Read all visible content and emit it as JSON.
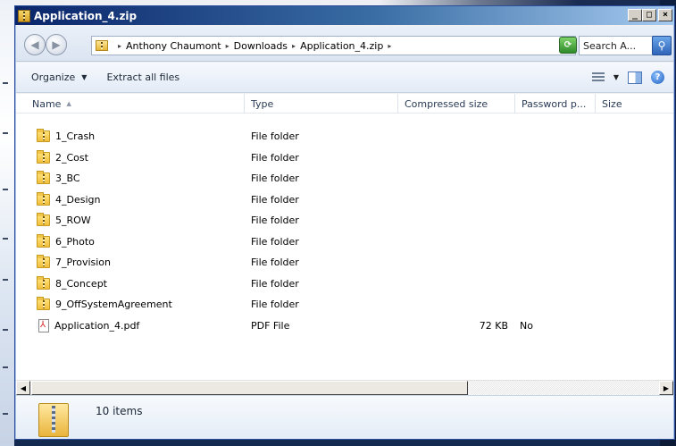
{
  "window": {
    "title": "Application_4.zip",
    "buttons": {
      "minimize": "_",
      "maximize": "□",
      "close": "×"
    }
  },
  "addressbar": {
    "back_icon": "back-arrow-icon",
    "forward_icon": "forward-arrow-icon",
    "breadcrumb": [
      "Anthony Chaumont",
      "Downloads",
      "Application_4.zip"
    ],
    "search_placeholder": "Search A..."
  },
  "commandbar": {
    "organize_label": "Organize",
    "extract_label": "Extract all files"
  },
  "list": {
    "columns": {
      "name": "Name",
      "type": "Type",
      "compressed": "Compressed size",
      "password": "Password p...",
      "size": "Size"
    },
    "rows": [
      {
        "name": "1_Crash",
        "type": "File folder",
        "compressed": "",
        "password": "",
        "icon": "folder-icon"
      },
      {
        "name": "2_Cost",
        "type": "File folder",
        "compressed": "",
        "password": "",
        "icon": "folder-icon"
      },
      {
        "name": "3_BC",
        "type": "File folder",
        "compressed": "",
        "password": "",
        "icon": "folder-icon"
      },
      {
        "name": "4_Design",
        "type": "File folder",
        "compressed": "",
        "password": "",
        "icon": "folder-icon"
      },
      {
        "name": "5_ROW",
        "type": "File folder",
        "compressed": "",
        "password": "",
        "icon": "folder-icon"
      },
      {
        "name": "6_Photo",
        "type": "File folder",
        "compressed": "",
        "password": "",
        "icon": "folder-icon"
      },
      {
        "name": "7_Provision",
        "type": "File folder",
        "compressed": "",
        "password": "",
        "icon": "folder-icon"
      },
      {
        "name": "8_Concept",
        "type": "File folder",
        "compressed": "",
        "password": "",
        "icon": "folder-icon"
      },
      {
        "name": "9_OffSystemAgreement",
        "type": "File folder",
        "compressed": "",
        "password": "",
        "icon": "folder-icon"
      },
      {
        "name": "Application_4.pdf",
        "type": "PDF File",
        "compressed": "72 KB",
        "password": "No",
        "icon": "pdf-icon"
      }
    ]
  },
  "details": {
    "item_count": "10 items"
  },
  "colors": {
    "titlebar_start": "#0a246a",
    "titlebar_end": "#a6caf0",
    "folder": "#f1bf3c"
  }
}
